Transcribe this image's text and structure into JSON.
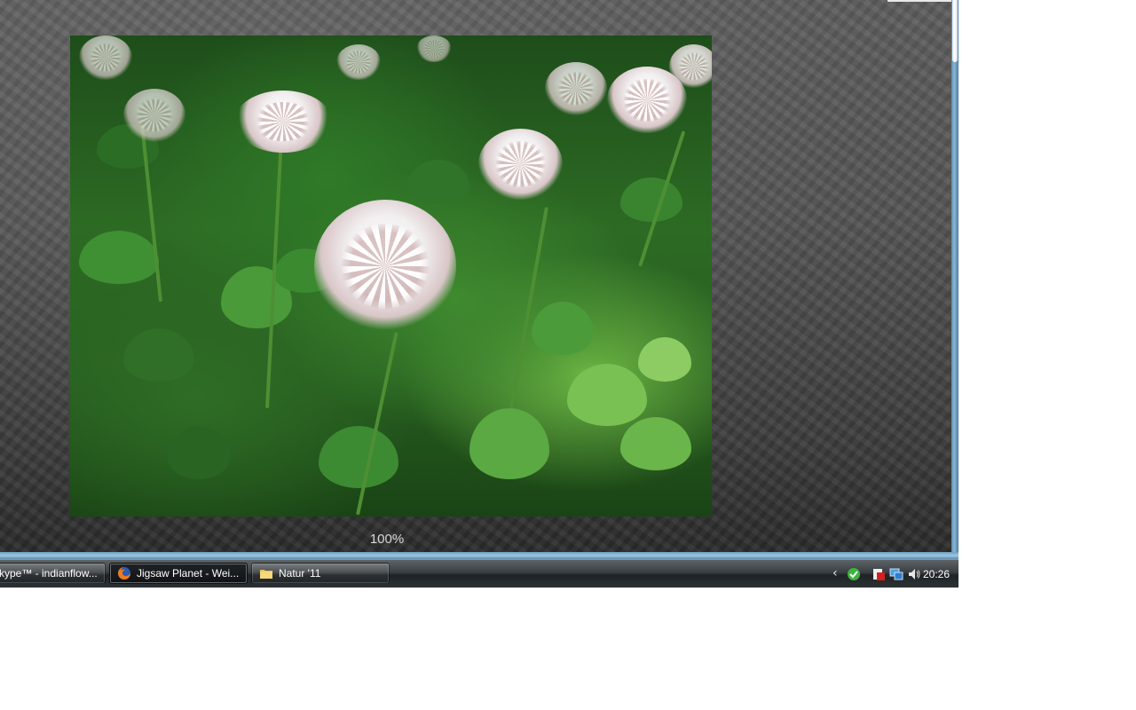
{
  "puzzle": {
    "zoom_label": "100%"
  },
  "taskbar": {
    "tasks": [
      {
        "label": "kype™ - indianflow...",
        "icon": "skype-icon",
        "active": false
      },
      {
        "label": "Jigsaw Planet - Wei...",
        "icon": "firefox-icon",
        "active": true
      },
      {
        "label": "Natur '11",
        "icon": "folder-icon",
        "active": false
      }
    ],
    "tray": {
      "expand_icon": "chevron-left-icon",
      "icons": [
        "checkmark-shield-icon",
        "security-icon",
        "network-icon",
        "volume-icon"
      ],
      "clock": "20:26"
    }
  },
  "colors": {
    "stage": "#4a4a4a",
    "taskbar": "#2c3135",
    "window_border": "#6b9fc1"
  }
}
